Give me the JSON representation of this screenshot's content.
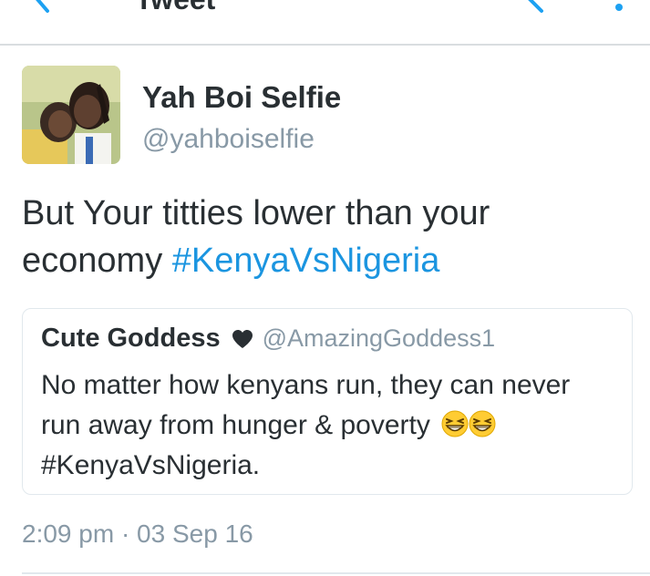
{
  "header": {
    "title": "Tweet",
    "back_icon": "back-arrow-icon",
    "share_icon": "share-icon",
    "more_icon": "more-vertical-icon",
    "accent_color": "#1da1f2"
  },
  "tweet": {
    "author_name": "Yah Boi Selfie",
    "author_handle": "@yahboiselfie",
    "text_line1": "But Your titties lower than your",
    "text_line2_prefix": "economy ",
    "hashtag": "#KenyaVsNigeria",
    "timestamp": "2:09 pm · 03 Sep 16"
  },
  "quoted_tweet": {
    "author_name": "Cute Goddess",
    "author_handle": "@AmazingGoddess1",
    "heart_icon": "heart-icon",
    "text_line1": "No matter how kenyans run, they can never",
    "text_line2": "run away from hunger & poverty",
    "emoji_icon": "grinning-squinting-face-emoji",
    "text_line3": "#KenyaVsNigeria."
  }
}
